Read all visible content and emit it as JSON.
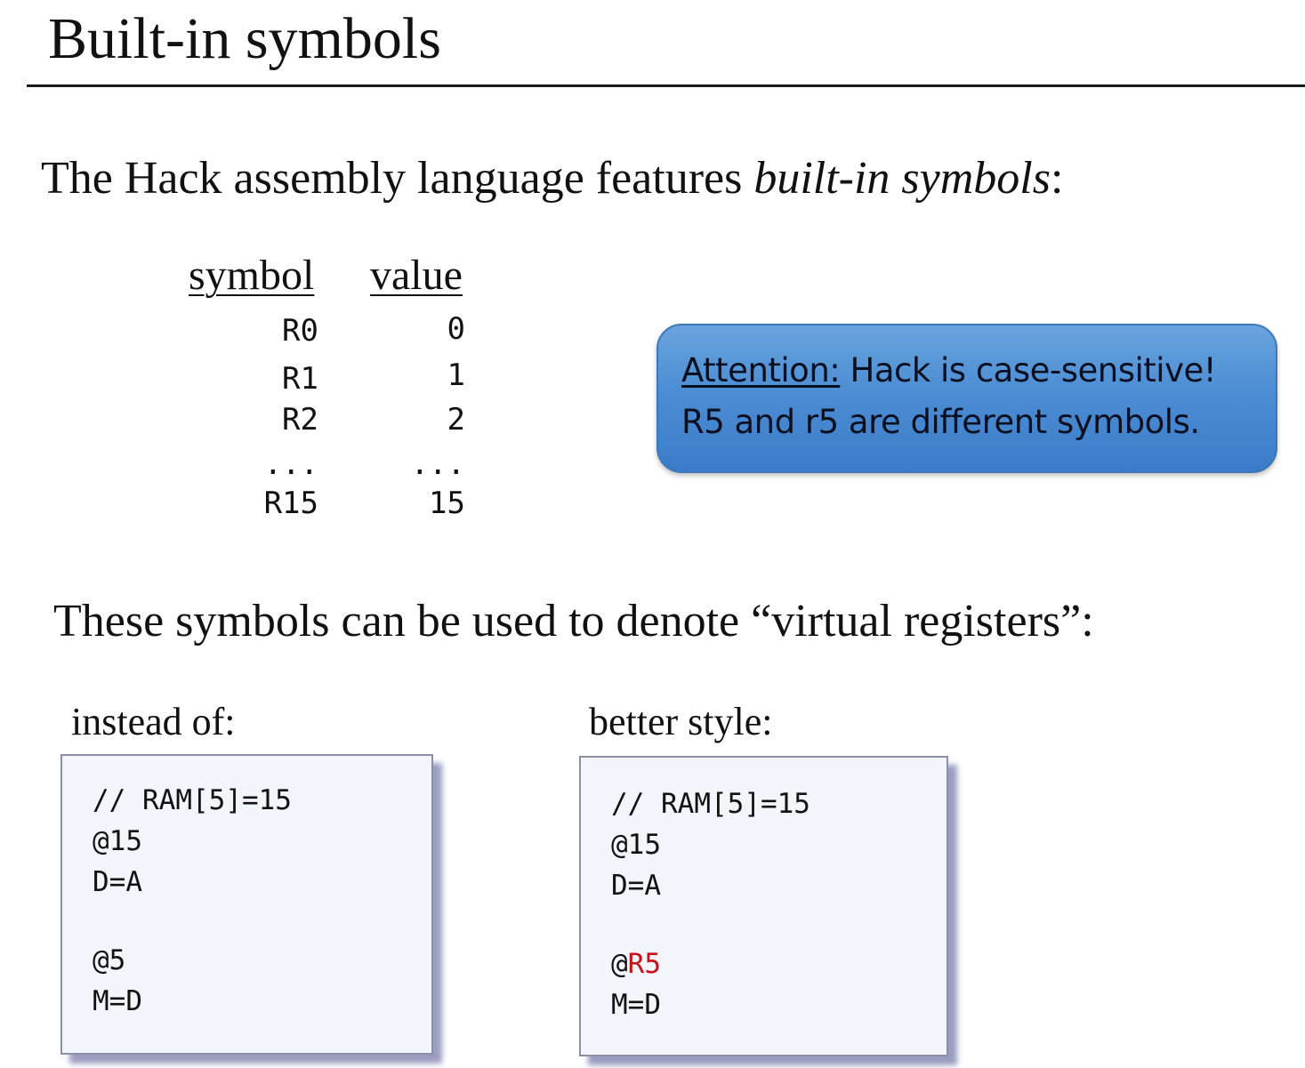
{
  "title": "Built-in symbols",
  "intro": {
    "before": "The Hack assembly language features ",
    "emphasis": "built-in symbols",
    "after": ":"
  },
  "table": {
    "headers": {
      "symbol": "symbol",
      "value": "value"
    },
    "rows": [
      {
        "symbol": "R0",
        "value": "0"
      },
      {
        "symbol": "R1",
        "value": "1"
      },
      {
        "symbol": "R2",
        "value": "2"
      },
      {
        "symbol": "...",
        "value": "..."
      },
      {
        "symbol": "R15",
        "value": "15"
      }
    ]
  },
  "callout": {
    "label": "Attention:",
    "line1_rest": " Hack is case-sensitive!",
    "line2": "R5 and r5 are different symbols.",
    "background_color": "#4c8dd3"
  },
  "registers_text": "These symbols can be used to denote “virtual registers”:",
  "examples": {
    "instead_of": {
      "label": "instead of:",
      "lines": [
        "// RAM[5]=15",
        "@15",
        "D=A",
        "",
        "@5",
        "M=D"
      ]
    },
    "better_style": {
      "label": "better style:",
      "lines": [
        "// RAM[5]=15",
        "@15",
        "D=A",
        "",
        "@",
        "M=D"
      ],
      "highlight": "R5",
      "highlight_color": "#c8121a"
    }
  }
}
